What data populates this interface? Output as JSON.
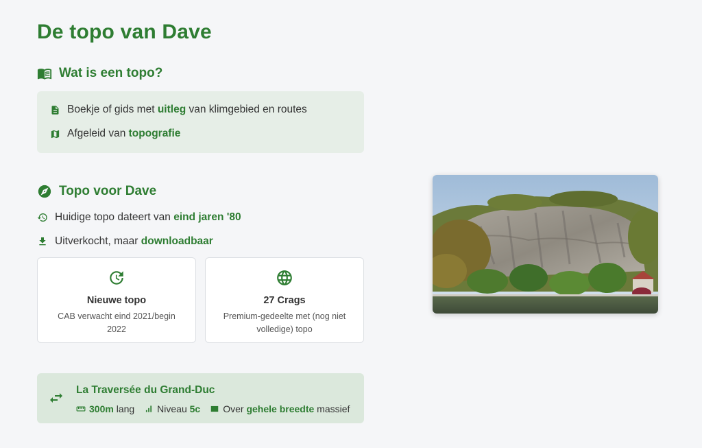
{
  "title": "De topo van Dave",
  "section1": {
    "heading": "Wat is een topo?",
    "rows": [
      {
        "pre": "Boekje of gids met ",
        "em": "uitleg",
        "post": " van klimgebied en routes",
        "icon": "file-icon"
      },
      {
        "pre": "Afgeleid van ",
        "em": "topografie",
        "post": "",
        "icon": "map-icon"
      }
    ]
  },
  "section2": {
    "heading": "Topo voor Dave",
    "history": {
      "pre": "Huidige topo dateert van ",
      "em": "eind jaren '80"
    },
    "download": {
      "pre": "Uitverkocht, maar ",
      "em": "downloadbaar"
    },
    "cards": [
      {
        "title": "Nieuwe topo",
        "text": "CAB verwacht eind 2021/begin 2022",
        "icon": "refresh-clock-icon"
      },
      {
        "title": "27 Crags",
        "text": "Premium-gedeelte met (nog niet volledige) topo",
        "icon": "globe-icon"
      }
    ]
  },
  "route": {
    "title": "La Traversée du Grand-Duc",
    "length_em": "300m",
    "length_post": " lang",
    "level_pre": "Niveau ",
    "level_em": "5c",
    "width_pre": "Over ",
    "width_em": "gehele breedte",
    "width_post": " massief"
  },
  "colors": {
    "accent": "#2e7d32",
    "box_bg": "#e6eee7",
    "route_bg": "#dbe8dc",
    "page_bg": "#f5f6f8"
  }
}
